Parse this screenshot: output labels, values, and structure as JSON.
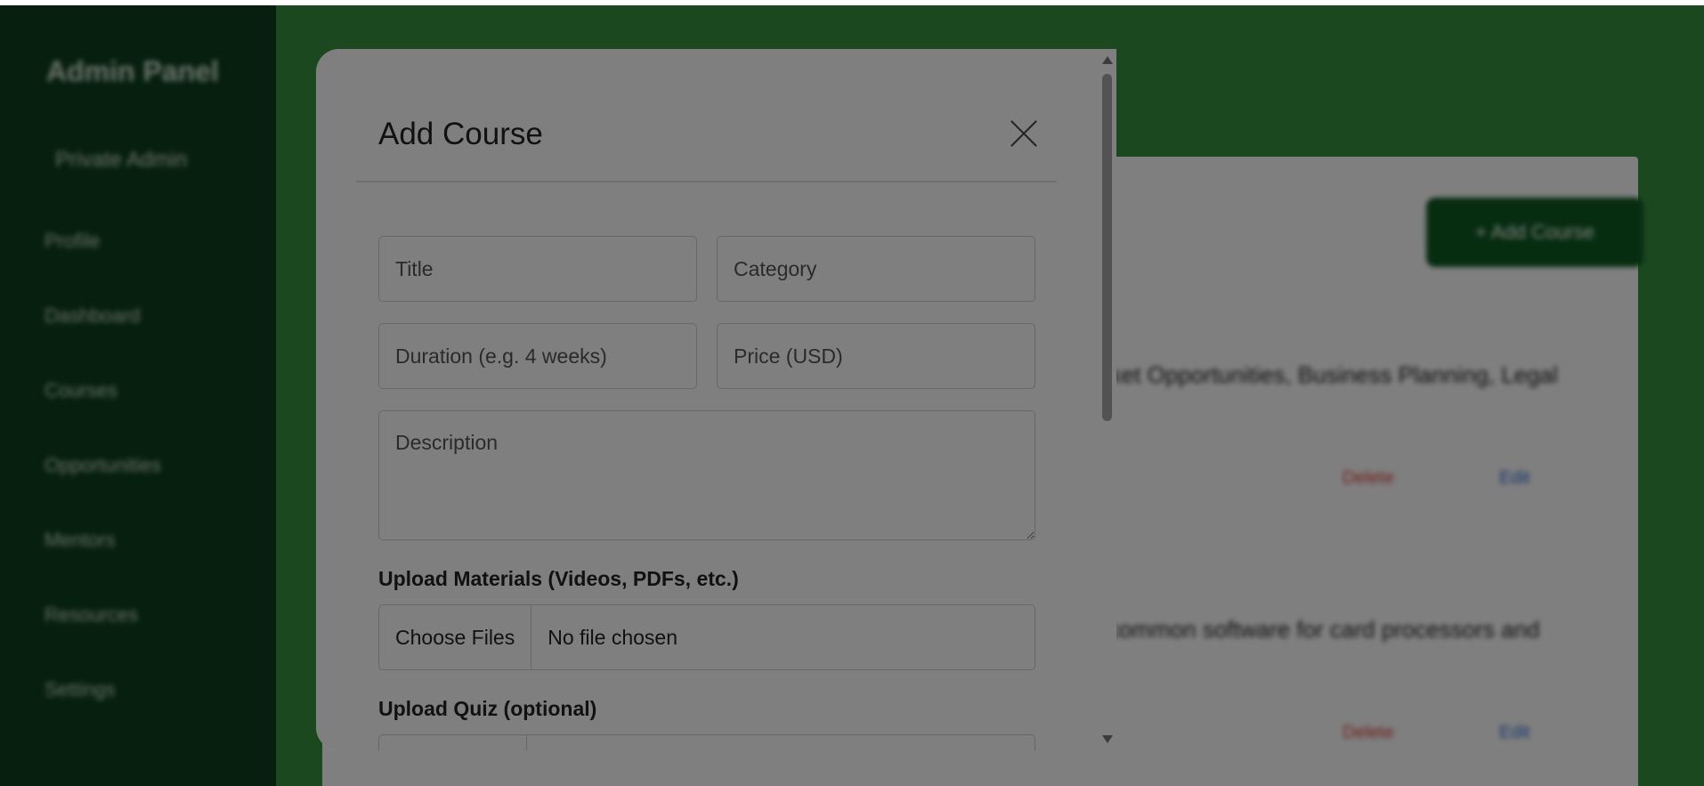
{
  "sidebar": {
    "brand": "Admin Panel",
    "role": "Private Admin",
    "items": [
      {
        "label": "Profile"
      },
      {
        "label": "Dashboard"
      },
      {
        "label": "Courses"
      },
      {
        "label": "Opportunities"
      },
      {
        "label": "Mentors"
      },
      {
        "label": "Resources"
      },
      {
        "label": "Settings"
      }
    ]
  },
  "main": {
    "add_course_button": "+ Add Course",
    "courses": [
      {
        "text": "Market Opportunities, Business Planning, Legal",
        "delete": "Delete",
        "edit": "Edit"
      },
      {
        "text": "ing common software for card processors and",
        "delete": "Delete",
        "edit": "Edit"
      }
    ]
  },
  "modal": {
    "title": "Add Course",
    "close_icon": "close-icon",
    "fields": {
      "title": {
        "placeholder": "Title",
        "value": ""
      },
      "category": {
        "placeholder": "Category",
        "value": ""
      },
      "duration": {
        "placeholder": "Duration (e.g. 4 weeks)",
        "value": ""
      },
      "price": {
        "placeholder": "Price (USD)",
        "value": ""
      },
      "description": {
        "placeholder": "Description",
        "value": ""
      }
    },
    "materials": {
      "label": "Upload Materials (Videos, PDFs, etc.)",
      "button": "Choose Files",
      "status": "No file chosen"
    },
    "quiz": {
      "label": "Upload Quiz (optional)"
    }
  },
  "colors": {
    "sidebar_bg": "#0e3f1c",
    "main_bg": "#37913d",
    "primary_button": "#0e5a22",
    "delete_link": "#e23a3a",
    "edit_link": "#2a6ad8"
  }
}
